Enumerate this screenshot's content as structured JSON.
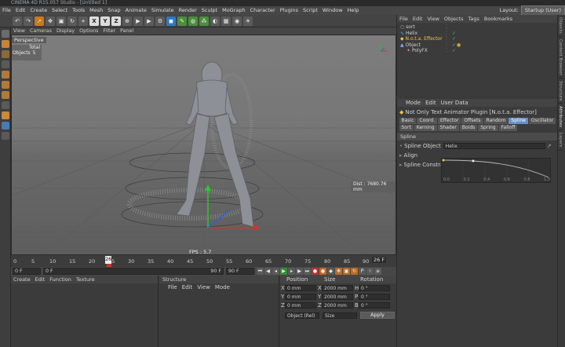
{
  "window": {
    "title": "CINEMA 4D R15.057 Studio - [Untitled 1]"
  },
  "menu": [
    "File",
    "Edit",
    "Create",
    "Select",
    "Tools",
    "Mesh",
    "Snap",
    "Animate",
    "Simulate",
    "Render",
    "Sculpt",
    "MoGraph",
    "Character",
    "Plugins",
    "Script",
    "Window",
    "Help"
  ],
  "layout": {
    "label": "Layout:",
    "value": "Startup (User)"
  },
  "toolbar": {
    "axis_x": "X",
    "axis_y": "Y",
    "axis_z": "Z"
  },
  "viewport": {
    "menu": [
      "View",
      "Cameras",
      "Display",
      "Options",
      "Filter",
      "Panel"
    ],
    "name": "Perspective",
    "stats_header": "Total",
    "stats_label": "Objects",
    "stats_value": "5",
    "fps": "FPS : 5.7",
    "distance": "Dist : 7680.76 mm"
  },
  "timeline": {
    "ticks": [
      "0",
      "5",
      "10",
      "15",
      "20",
      "25",
      "26",
      "30",
      "35",
      "40",
      "45",
      "50",
      "55",
      "60",
      "65",
      "70",
      "75",
      "80",
      "85",
      "90"
    ],
    "current_frame": "26",
    "frame_field": "26 F",
    "start": "0 F",
    "start2": "0 F",
    "end": "90 F",
    "end2": "90 F"
  },
  "material_manager": {
    "menu": [
      "Create",
      "Edit",
      "Function",
      "Texture"
    ]
  },
  "structure": {
    "title": "Structure",
    "menu": [
      "File",
      "Edit",
      "View",
      "Mode"
    ]
  },
  "coordinates": {
    "headers": [
      "Position",
      "Size",
      "Rotation"
    ],
    "rows": [
      {
        "axis": "X",
        "pos": "0 mm",
        "size_axis": "X",
        "size": "2000 mm",
        "rot_axis": "H",
        "rot": "0 °"
      },
      {
        "axis": "Y",
        "pos": "0 mm",
        "size_axis": "Y",
        "size": "2000 mm",
        "rot_axis": "P",
        "rot": "0 °"
      },
      {
        "axis": "Z",
        "pos": "0 mm",
        "size_axis": "Z",
        "size": "2000 mm",
        "rot_axis": "B",
        "rot": "0 °"
      }
    ],
    "mode": "Object (Rel)",
    "size_mode": "Size",
    "apply": "Apply"
  },
  "objects": {
    "menu": [
      "File",
      "Edit",
      "View",
      "Objects",
      "Tags",
      "Bookmarks"
    ],
    "items": [
      {
        "name": "sort",
        "indent": 0
      },
      {
        "name": "Helix",
        "indent": 0
      },
      {
        "name": "N.o.t.a. Effector",
        "indent": 0,
        "highlight": true
      },
      {
        "name": "Object",
        "indent": 0
      },
      {
        "name": "PolyFX",
        "indent": 1
      }
    ]
  },
  "attributes": {
    "menu": [
      "Mode",
      "Edit",
      "User Data"
    ],
    "title": "Not Only Text Animator Plugin [N.o.t.a. Effector]",
    "tabs_row1": [
      "Basic",
      "Coord.",
      "Effector",
      "Offsets",
      "Random",
      "Spline",
      "Oscillator"
    ],
    "tabs_row2": [
      "Sort",
      "Kerning",
      "Shader",
      "Boids",
      "Spring",
      "Falloff"
    ],
    "active_tab": "Spline",
    "section": "Spline",
    "spline_object_label": "Spline Object",
    "spline_object_value": "Helix",
    "align_label": "Align",
    "constrain_label": "Spline Constrain",
    "graph_ticks": [
      "0.0",
      "0.2",
      "0.4",
      "0.6",
      "0.8",
      "1.0"
    ]
  },
  "right_tabs": [
    "Objects",
    "Content Browser",
    "Structure",
    "Attributes",
    "Layers"
  ],
  "colors": {
    "accent": "#6b8fc4",
    "highlight_text": "#f0c040",
    "x_axis": "#d03030",
    "y_axis": "#30c030",
    "z_axis": "#3060e0"
  }
}
